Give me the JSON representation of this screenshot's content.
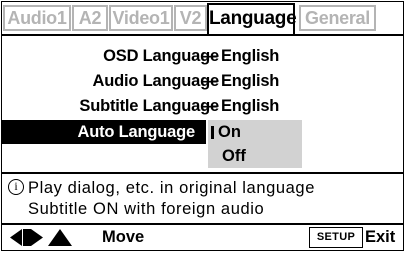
{
  "tabs": [
    {
      "label": "Audio1",
      "active": false
    },
    {
      "label": "A2",
      "active": false
    },
    {
      "label": "Video1",
      "active": false
    },
    {
      "label": "V2",
      "active": false
    },
    {
      "label": "Language",
      "active": true
    },
    {
      "label": "General",
      "active": false
    }
  ],
  "settings": [
    {
      "label": "OSD Language",
      "separator": "—",
      "value": "English"
    },
    {
      "label": "Audio Language",
      "separator": "—",
      "value": "English"
    },
    {
      "label": "Subtitle Language",
      "separator": "—",
      "value": "English"
    },
    {
      "label": "Auto Language",
      "selected": true
    }
  ],
  "auto_language_options": [
    {
      "label": "On",
      "current": true
    },
    {
      "label": "Off",
      "current": false
    }
  ],
  "info": {
    "icon": "info-circle-icon",
    "line1": "Play dialog, etc. in original language",
    "line2": "Subtitle ON with foreign audio"
  },
  "footer": {
    "nav_icon": "left-right-up-arrows-icon",
    "move_label": "Move",
    "setup_label": "SETUP",
    "exit_label": "Exit"
  },
  "colors": {
    "inactive_tab": "#b4b4b4",
    "selected_row": "#000000",
    "options_bg": "#d2d2d2"
  }
}
